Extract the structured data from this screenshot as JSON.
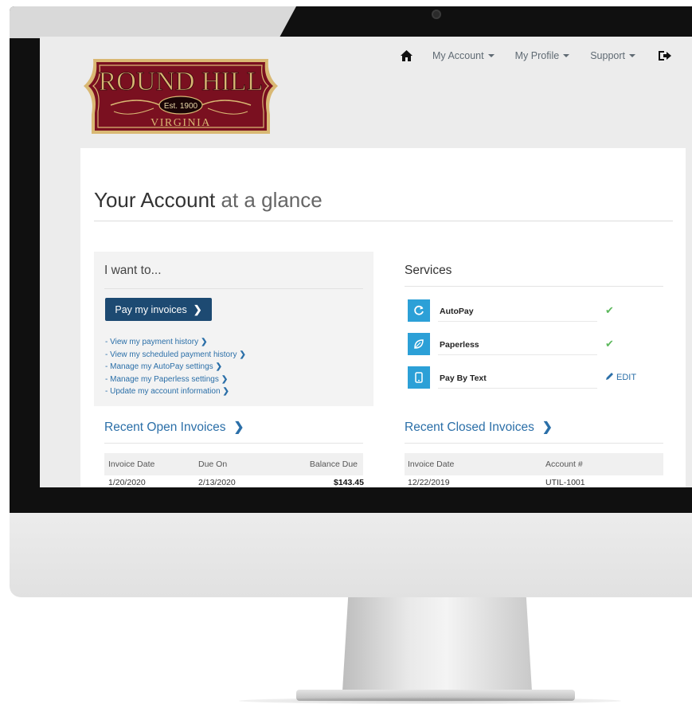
{
  "logo": {
    "line1": "ROUND HILL",
    "established": "Est. 1900",
    "line2": "VIRGINIA"
  },
  "nav": {
    "home_icon": "home-icon",
    "my_account": "My Account",
    "my_profile": "My Profile",
    "support": "Support",
    "logout_icon": "sign-out-icon"
  },
  "page": {
    "title_main": "Your Account",
    "title_light": "at a glance"
  },
  "i_want": {
    "heading": "I want to...",
    "pay_button": "Pay my invoices",
    "links": [
      "- View my payment history",
      "- View my scheduled payment history",
      "- Manage my AutoPay settings",
      "- Manage my Paperless settings",
      "- Update my account information"
    ]
  },
  "services": {
    "heading": "Services",
    "items": [
      {
        "label": "AutoPay",
        "icon": "refresh-icon",
        "status": "✔",
        "enabled": true
      },
      {
        "label": "Paperless",
        "icon": "leaf-icon",
        "status": "✔",
        "enabled": true
      },
      {
        "label": "Pay By Text",
        "icon": "mobile-phone-icon",
        "action": "EDIT",
        "enabled": false
      }
    ],
    "accent_color": "#2ca0d7"
  },
  "open_invoices": {
    "heading": "Recent Open Invoices",
    "columns": [
      "Invoice Date",
      "Due On",
      "Balance Due"
    ],
    "rows": [
      [
        "1/20/2020",
        "2/13/2020",
        "$143.45"
      ]
    ]
  },
  "closed_invoices": {
    "heading": "Recent Closed Invoices",
    "columns": [
      "Invoice Date",
      "Account #"
    ],
    "rows": [
      [
        "12/22/2019",
        "UTIL-1001"
      ]
    ]
  },
  "colors": {
    "primary_button": "#1d4a72",
    "link": "#2b6fa8",
    "check": "#5cb85c",
    "logo_red": "#7a1020",
    "logo_gold": "#d9b873"
  }
}
